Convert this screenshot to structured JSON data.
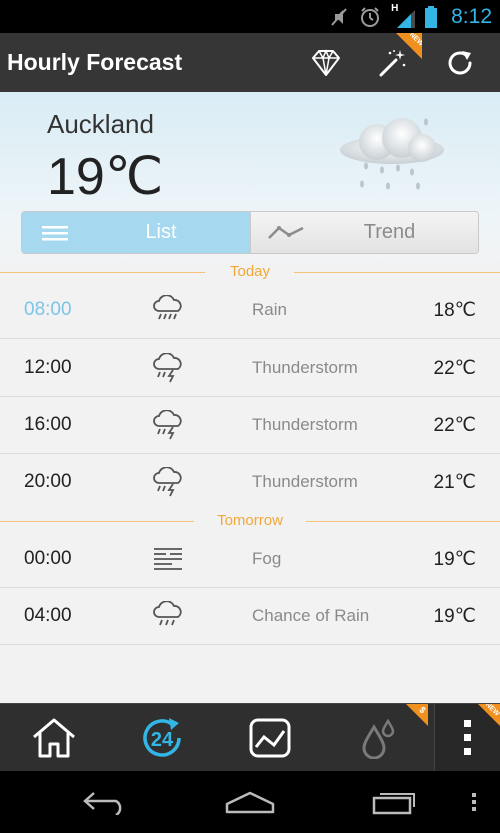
{
  "status_bar": {
    "time": "8:12",
    "network_label": "H",
    "icons": [
      "mute-icon",
      "alarm-icon",
      "signal-icon",
      "battery-icon"
    ]
  },
  "action_bar": {
    "title": "Hourly Forecast",
    "actions": [
      {
        "name": "premium-diamond-icon"
      },
      {
        "name": "magic-wand-icon",
        "badge": "NEW"
      },
      {
        "name": "refresh-icon"
      }
    ]
  },
  "current": {
    "city": "Auckland",
    "temperature": "19℃",
    "condition_icon": "rain-cloud-icon"
  },
  "view_toggle": {
    "list_label": "List",
    "trend_label": "Trend",
    "selected": "List"
  },
  "sections": [
    {
      "day": "Today",
      "rows": [
        {
          "time": "08:00",
          "condition": "Rain",
          "temp": "18℃",
          "icon": "rain-icon",
          "current": true
        },
        {
          "time": "12:00",
          "condition": "Thunderstorm",
          "temp": "22℃",
          "icon": "thunderstorm-icon"
        },
        {
          "time": "16:00",
          "condition": "Thunderstorm",
          "temp": "22℃",
          "icon": "thunderstorm-icon"
        },
        {
          "time": "20:00",
          "condition": "Thunderstorm",
          "temp": "21℃",
          "icon": "thunderstorm-icon"
        }
      ]
    },
    {
      "day": "Tomorrow",
      "rows": [
        {
          "time": "00:00",
          "condition": "Fog",
          "temp": "19℃",
          "icon": "fog-icon"
        },
        {
          "time": "04:00",
          "condition": "Chance of Rain",
          "temp": "19℃",
          "icon": "chance-rain-icon"
        }
      ]
    }
  ],
  "bottom_nav": {
    "items": [
      {
        "name": "home-icon"
      },
      {
        "name": "hourly-24-icon",
        "active": true
      },
      {
        "name": "trend-chart-icon"
      },
      {
        "name": "humidity-drops-icon",
        "badge": "$"
      },
      {
        "name": "overflow-menu-icon",
        "badge": "NEW"
      }
    ]
  },
  "system_nav": [
    "back-icon",
    "home-nav-icon",
    "recent-apps-icon",
    "menu-dots-icon"
  ],
  "colors": {
    "accent_blue": "#33b5e5",
    "list_selected": "#a6d8ef",
    "divider_orange": "#f0a83a",
    "action_bar": "#363636"
  }
}
